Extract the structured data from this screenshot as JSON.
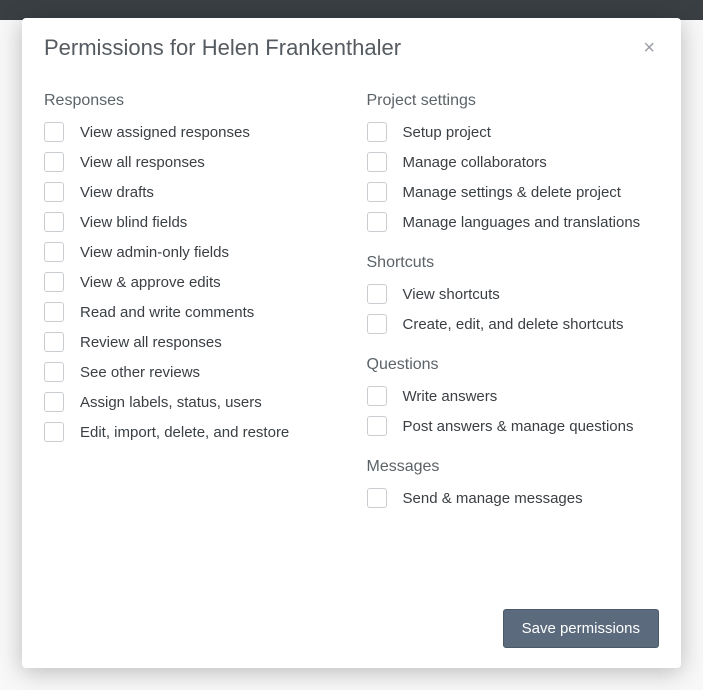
{
  "modal": {
    "title": "Permissions for Helen Frankenthaler",
    "save_label": "Save permissions"
  },
  "sections": {
    "responses": {
      "title": "Responses",
      "items": [
        "View assigned responses",
        "View all responses",
        "View drafts",
        "View blind fields",
        "View admin-only fields",
        "View & approve edits",
        "Read and write comments",
        "Review all responses",
        "See other reviews",
        "Assign labels, status, users",
        "Edit, import, delete, and restore"
      ]
    },
    "project_settings": {
      "title": "Project settings",
      "items": [
        "Setup project",
        "Manage collaborators",
        "Manage settings & delete project",
        "Manage languages and translations"
      ]
    },
    "shortcuts": {
      "title": "Shortcuts",
      "items": [
        "View shortcuts",
        "Create, edit, and delete shortcuts"
      ]
    },
    "questions": {
      "title": "Questions",
      "items": [
        "Write answers",
        "Post answers & manage questions"
      ]
    },
    "messages": {
      "title": "Messages",
      "items": [
        "Send & manage messages"
      ]
    }
  }
}
